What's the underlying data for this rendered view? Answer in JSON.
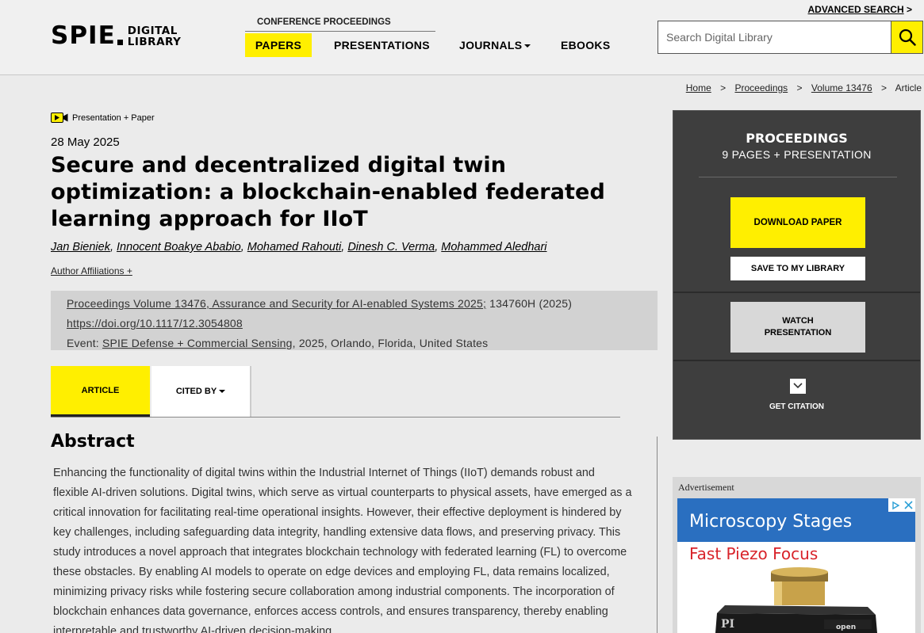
{
  "header": {
    "logo_main": "SPIE",
    "logo_sub_1": "DIGITAL",
    "logo_sub_2": "LIBRARY",
    "advanced_search": "ADVANCED SEARCH",
    "advanced_search_arrow": ">",
    "conference_label": "CONFERENCE PROCEEDINGS",
    "nav": {
      "papers": "PAPERS",
      "presentations": "PRESENTATIONS",
      "journals": "JOURNALS",
      "ebooks": "EBOOKS"
    },
    "search_placeholder": "Search Digital Library"
  },
  "breadcrumb": {
    "home": "Home",
    "proceedings": "Proceedings",
    "volume": "Volume 13476",
    "article": "Article",
    "sep": ">"
  },
  "article": {
    "badge": "Presentation + Paper",
    "date": "28 May 2025",
    "title": "Secure and decentralized digital twin optimization: a blockchain-enabled federated learning approach for IIoT",
    "authors": [
      "Jan Bieniek",
      "Innocent Boakye Ababio",
      "Mohamed Rahouti",
      "Dinesh C. Verma",
      "Mohammed Aledhari"
    ],
    "author_sep": ", ",
    "affiliations": "Author Affiliations +",
    "proceedings_link": "Proceedings Volume 13476, Assurance and Security for AI-enabled Systems 2025;",
    "proceedings_id": " 134760H (2025)",
    "doi": "https://doi.org/10.1117/12.3054808",
    "event_label": "Event: ",
    "event_link": "SPIE Defense + Commercial Sensing",
    "event_rest": ", 2025, Orlando, Florida, United States",
    "tab_article": "ARTICLE",
    "tab_cited": "CITED BY",
    "abstract_heading": "Abstract",
    "abstract_text": "Enhancing the functionality of digital twins within the Industrial Internet of Things (IIoT) demands robust and flexible AI-driven solutions. Digital twins, which serve as virtual counterparts to physical assets, have emerged as a critical innovation for facilitating real-time operational insights. However, their effective deployment is hindered by key challenges, including safeguarding data integrity, handling extensive data flows, and preserving privacy. This study introduces a novel approach that integrates blockchain technology with federated learning (FL) to overcome these obstacles. By enabling AI models to operate on edge devices and employing FL, data remains localized, minimizing privacy risks while fostering secure collaboration among industrial components. The incorporation of blockchain enhances data governance, enforces access controls, and ensures transparency, thereby enabling interpretable and trustworthy AI-driven decision-making"
  },
  "sidebar": {
    "title": "PROCEEDINGS",
    "subtitle": "9 PAGES + PRESENTATION",
    "download": "DOWNLOAD PAPER",
    "save": "SAVE TO MY LIBRARY",
    "watch_1": "WATCH",
    "watch_2": "PRESENTATION",
    "citation": "GET CITATION"
  },
  "ad": {
    "label": "Advertisement",
    "headline": "Microscopy Stages",
    "subline": "Fast Piezo Focus",
    "open_text": "open",
    "brand": "PI"
  },
  "colors": {
    "accent_yellow": "#ffef00",
    "sidebar_dark": "#3e3e3e",
    "ad_blue": "#2a6fc0",
    "ad_red": "#d8232a"
  }
}
